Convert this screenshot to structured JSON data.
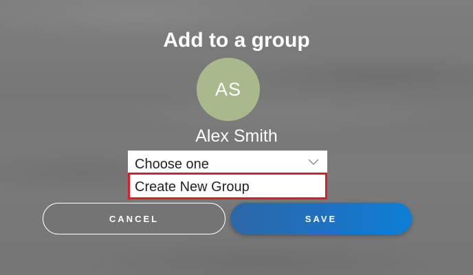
{
  "dialog": {
    "title": "Add to a group",
    "avatar": {
      "initials": "AS",
      "color": "#a9b98b"
    },
    "user_name": "Alex Smith",
    "group_select": {
      "selected": "Choose one",
      "icon": "chevron-down-icon",
      "options": [
        "Create New Group"
      ]
    },
    "highlight_color": "#e01b24",
    "buttons": {
      "cancel": "CANCEL",
      "save": "SAVE"
    },
    "save_color": "#1d72c2"
  }
}
